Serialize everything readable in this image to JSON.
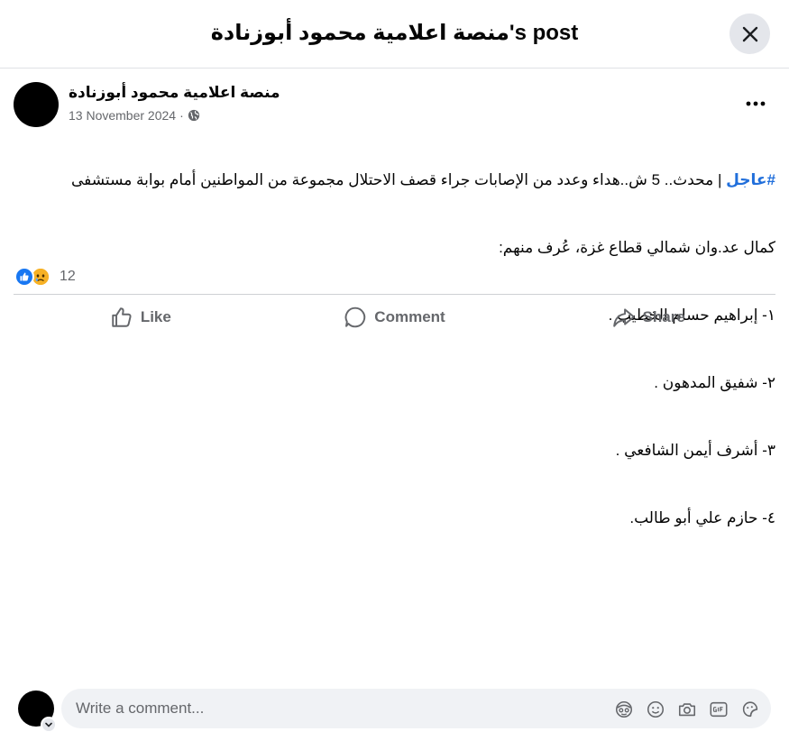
{
  "header": {
    "title": "منصة اعلامية محمود أبوزنادة's post"
  },
  "post": {
    "author": "منصة اعلامية محمود أبوزنادة",
    "date": "13 November 2024",
    "meta_separator": "·",
    "hashtag": "#عاجل",
    "line1_rest": " | محدث..  5 ش..هداء وعدد من الإصابات جراء قصف الاحتلال مجموعة من المواطنين أمام بوابة مستشفى",
    "line2": "كمال عد.وان شمالي قطاع غزة، عُرف منهم:",
    "names": [
      "١- إبراهيم حسام الخطيب .",
      "٢-  شفيق المدهون .",
      "٣- أشرف أيمن الشافعي .",
      "٤- حازم علي أبو طالب."
    ]
  },
  "reactions": {
    "count": "12",
    "types": [
      "like-icon",
      "sad-icon"
    ],
    "like_color": "#1877f2",
    "sad_color": "#f7b125"
  },
  "actions": {
    "like": "Like",
    "comment": "Comment",
    "share": "Share"
  },
  "composer": {
    "placeholder": "Write a comment...",
    "icons": [
      "avatar-sticker-icon",
      "emoji-icon",
      "camera-icon",
      "gif-icon",
      "sticker-icon"
    ]
  },
  "colors": {
    "hashtag": "#216fdb",
    "secondary_text": "#65676b",
    "close_bg": "#e4e6eb",
    "composer_bg": "#f0f2f5"
  }
}
